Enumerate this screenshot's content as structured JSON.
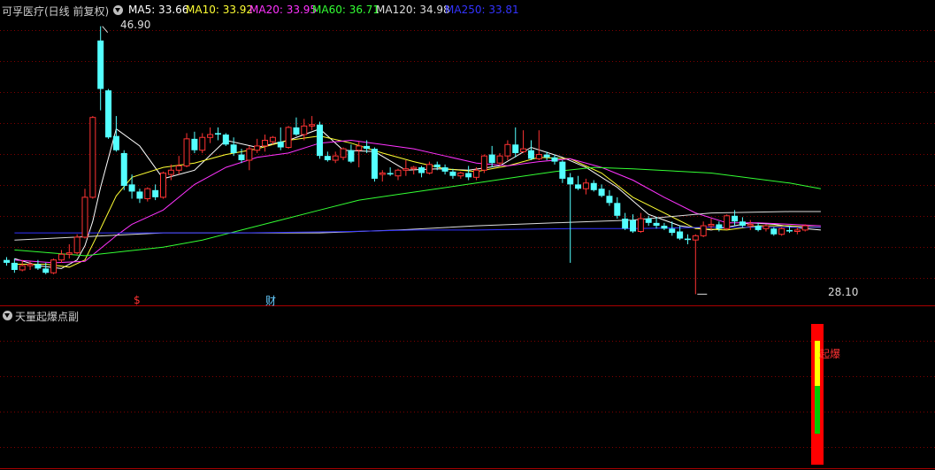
{
  "header": {
    "title": "可孚医疗(日线 前复权)",
    "ma": [
      {
        "label": "MA5: 33.66",
        "color": "#ffffff"
      },
      {
        "label": "MA10: 33.92",
        "color": "#ffff33"
      },
      {
        "label": "MA20: 33.95",
        "color": "#ff33ff"
      },
      {
        "label": "MA60: 36.71",
        "color": "#33ff33"
      },
      {
        "label": "MA120: 34.98",
        "color": "#dddddd"
      },
      {
        "label": "MA250: 33.81",
        "color": "#3333ff"
      }
    ]
  },
  "annotations": {
    "high": "46.90",
    "low": "28.10",
    "marker_dollar": "$",
    "marker_cai": "财"
  },
  "sub": {
    "title": "天量起爆点副",
    "signal_label": "起爆"
  },
  "colors": {
    "up": "#ff3333",
    "down": "#54ffff",
    "grid": "#800000",
    "signal_bar": "#ff0000",
    "signal_mid": "#ffff00",
    "signal_low": "#00cc00"
  },
  "chart_data": {
    "type": "candlestick",
    "y_range": [
      27.5,
      47.5
    ],
    "candles": [
      [
        30.5,
        30.7,
        30.1,
        30.3
      ],
      [
        30.3,
        30.6,
        29.6,
        29.8
      ],
      [
        29.8,
        30.5,
        29.7,
        30.1
      ],
      [
        30.1,
        30.4,
        29.8,
        30.2
      ],
      [
        30.2,
        30.5,
        29.8,
        29.9
      ],
      [
        29.9,
        30.3,
        29.5,
        29.6
      ],
      [
        29.6,
        30.6,
        29.5,
        30.5
      ],
      [
        30.5,
        31.2,
        30.3,
        30.9
      ],
      [
        30.9,
        31.6,
        30.6,
        31.0
      ],
      [
        31.0,
        32.3,
        30.9,
        32.1
      ],
      [
        32.1,
        35.5,
        32.0,
        34.9
      ],
      [
        34.9,
        40.6,
        34.8,
        40.5
      ],
      [
        45.9,
        46.9,
        41.0,
        42.5
      ],
      [
        42.4,
        42.5,
        39.0,
        39.1
      ],
      [
        39.2,
        40.6,
        38.1,
        38.2
      ],
      [
        38.0,
        38.2,
        35.4,
        35.7
      ],
      [
        35.8,
        36.5,
        34.8,
        35.3
      ],
      [
        35.3,
        35.5,
        34.5,
        34.8
      ],
      [
        34.8,
        35.6,
        34.6,
        35.5
      ],
      [
        35.4,
        35.8,
        34.7,
        34.9
      ],
      [
        34.9,
        36.7,
        34.8,
        36.6
      ],
      [
        36.5,
        37.2,
        36.1,
        36.8
      ],
      [
        36.8,
        37.8,
        36.5,
        37.1
      ],
      [
        37.1,
        39.4,
        37.0,
        39.0
      ],
      [
        39.0,
        39.5,
        38.0,
        38.2
      ],
      [
        38.2,
        39.4,
        38.0,
        39.1
      ],
      [
        39.1,
        39.8,
        38.7,
        39.3
      ],
      [
        39.4,
        39.8,
        38.9,
        39.3
      ],
      [
        39.3,
        39.4,
        38.5,
        38.6
      ],
      [
        38.6,
        39.1,
        37.8,
        38.0
      ],
      [
        37.9,
        38.3,
        37.3,
        37.5
      ],
      [
        37.5,
        38.5,
        36.8,
        38.3
      ],
      [
        38.2,
        39.0,
        38.0,
        38.5
      ],
      [
        38.5,
        39.3,
        38.1,
        38.9
      ],
      [
        38.8,
        39.2,
        38.6,
        39.1
      ],
      [
        38.8,
        39.8,
        38.2,
        38.4
      ],
      [
        38.4,
        39.9,
        38.3,
        39.8
      ],
      [
        39.8,
        40.5,
        39.2,
        39.3
      ],
      [
        39.3,
        40.4,
        38.9,
        39.9
      ],
      [
        39.9,
        40.6,
        39.6,
        40.0
      ],
      [
        40.0,
        40.2,
        37.6,
        37.8
      ],
      [
        37.8,
        38.1,
        37.4,
        37.5
      ],
      [
        37.5,
        38.1,
        37.3,
        37.8
      ],
      [
        37.7,
        38.4,
        37.5,
        38.3
      ],
      [
        38.2,
        38.6,
        37.3,
        37.4
      ],
      [
        38.2,
        38.8,
        37.0,
        38.5
      ],
      [
        38.5,
        38.9,
        38.0,
        38.3
      ],
      [
        38.3,
        38.4,
        36.0,
        36.2
      ],
      [
        36.5,
        36.8,
        36.0,
        36.6
      ],
      [
        36.6,
        37.0,
        36.4,
        36.5
      ],
      [
        36.4,
        36.9,
        36.1,
        36.8
      ],
      [
        36.8,
        37.5,
        36.4,
        36.9
      ],
      [
        36.9,
        37.1,
        36.5,
        37.0
      ],
      [
        37.0,
        37.1,
        36.3,
        36.6
      ],
      [
        36.6,
        37.4,
        36.5,
        37.2
      ],
      [
        37.2,
        37.4,
        36.8,
        37.0
      ],
      [
        37.0,
        37.2,
        36.5,
        36.7
      ],
      [
        36.7,
        36.9,
        36.2,
        36.4
      ],
      [
        36.4,
        36.7,
        36.2,
        36.6
      ],
      [
        36.6,
        37.1,
        36.1,
        36.3
      ],
      [
        36.3,
        37.0,
        36.1,
        36.8
      ],
      [
        36.8,
        37.9,
        36.6,
        37.8
      ],
      [
        37.9,
        38.5,
        37.0,
        37.3
      ],
      [
        37.3,
        38.0,
        37.1,
        37.8
      ],
      [
        37.8,
        38.9,
        37.5,
        38.6
      ],
      [
        38.6,
        39.8,
        37.7,
        38.0
      ],
      [
        38.1,
        39.6,
        38.0,
        38.3
      ],
      [
        38.2,
        38.9,
        37.5,
        37.6
      ],
      [
        37.6,
        39.6,
        37.5,
        37.9
      ],
      [
        37.9,
        38.1,
        37.5,
        37.7
      ],
      [
        37.7,
        37.9,
        37.2,
        37.4
      ],
      [
        37.4,
        37.5,
        35.9,
        36.2
      ],
      [
        36.3,
        36.6,
        30.3,
        35.8
      ],
      [
        35.8,
        36.4,
        35.4,
        35.5
      ],
      [
        35.5,
        36.2,
        35.1,
        35.9
      ],
      [
        35.9,
        36.1,
        35.3,
        35.4
      ],
      [
        35.5,
        35.8,
        34.9,
        35.0
      ],
      [
        35.0,
        35.4,
        34.3,
        34.5
      ],
      [
        34.5,
        34.9,
        33.4,
        33.6
      ],
      [
        33.4,
        33.8,
        32.6,
        32.7
      ],
      [
        33.3,
        33.7,
        32.4,
        32.5
      ],
      [
        32.5,
        33.8,
        32.4,
        33.4
      ],
      [
        33.4,
        33.6,
        32.9,
        33.1
      ],
      [
        33.1,
        33.5,
        32.7,
        32.9
      ],
      [
        32.9,
        33.1,
        32.6,
        32.7
      ],
      [
        32.7,
        33.2,
        32.2,
        32.4
      ],
      [
        32.5,
        32.9,
        31.9,
        32.0
      ],
      [
        32.0,
        32.3,
        31.6,
        31.9
      ],
      [
        31.9,
        32.3,
        28.1,
        32.2
      ],
      [
        32.2,
        33.2,
        32.1,
        32.9
      ],
      [
        32.9,
        33.4,
        32.6,
        33.0
      ],
      [
        33.0,
        33.2,
        32.5,
        32.7
      ],
      [
        32.7,
        33.7,
        32.6,
        33.6
      ],
      [
        33.6,
        34.0,
        32.9,
        33.2
      ],
      [
        33.2,
        33.5,
        32.8,
        32.9
      ],
      [
        32.9,
        33.3,
        32.6,
        33.0
      ],
      [
        32.9,
        33.1,
        32.5,
        32.6
      ],
      [
        32.7,
        33.0,
        32.5,
        32.9
      ],
      [
        32.7,
        32.8,
        32.2,
        32.3
      ],
      [
        32.3,
        32.8,
        32.2,
        32.7
      ],
      [
        32.6,
        32.9,
        32.4,
        32.5
      ],
      [
        32.5,
        32.8,
        32.3,
        32.6
      ],
      [
        32.6,
        33.0,
        32.5,
        32.9
      ]
    ],
    "ma_series": [
      {
        "name": "MA5",
        "color": "#ffffff",
        "points": [
          [
            1,
            30.6
          ],
          [
            4,
            30.1
          ],
          [
            7,
            29.9
          ],
          [
            9,
            30.5
          ],
          [
            10,
            31.5
          ],
          [
            11,
            33.2
          ],
          [
            12,
            35.6
          ],
          [
            14,
            39.7
          ],
          [
            17,
            38.5
          ],
          [
            20,
            36.2
          ],
          [
            24,
            36.8
          ],
          [
            28,
            38.9
          ],
          [
            32,
            38.4
          ],
          [
            36,
            38.9
          ],
          [
            40,
            39.7
          ],
          [
            43,
            38.2
          ],
          [
            47,
            38.1
          ],
          [
            51,
            36.8
          ],
          [
            55,
            36.9
          ],
          [
            59,
            36.8
          ],
          [
            63,
            37.1
          ],
          [
            67,
            38.4
          ],
          [
            71,
            37.7
          ],
          [
            74,
            37.0
          ],
          [
            78,
            35.6
          ],
          [
            82,
            33.7
          ],
          [
            86,
            32.9
          ],
          [
            90,
            32.6
          ],
          [
            95,
            33.1
          ],
          [
            98,
            33.0
          ],
          [
            102,
            32.7
          ],
          [
            104,
            32.6
          ]
        ]
      },
      {
        "name": "MA10",
        "color": "#ffff33",
        "points": [
          [
            1,
            30.2
          ],
          [
            5,
            30.2
          ],
          [
            8,
            30.0
          ],
          [
            10,
            30.5
          ],
          [
            12,
            32.7
          ],
          [
            14,
            35.0
          ],
          [
            16,
            36.3
          ],
          [
            20,
            37.0
          ],
          [
            24,
            37.3
          ],
          [
            28,
            37.9
          ],
          [
            32,
            38.3
          ],
          [
            36,
            38.9
          ],
          [
            40,
            39.2
          ],
          [
            44,
            38.7
          ],
          [
            48,
            38.0
          ],
          [
            52,
            37.4
          ],
          [
            56,
            36.9
          ],
          [
            60,
            36.7
          ],
          [
            64,
            37.1
          ],
          [
            68,
            37.7
          ],
          [
            72,
            37.6
          ],
          [
            76,
            36.6
          ],
          [
            80,
            34.9
          ],
          [
            84,
            33.8
          ],
          [
            88,
            32.7
          ],
          [
            92,
            32.6
          ],
          [
            96,
            32.9
          ],
          [
            100,
            32.9
          ],
          [
            104,
            32.8
          ]
        ]
      },
      {
        "name": "MA20",
        "color": "#ff33ff",
        "points": [
          [
            1,
            30.5
          ],
          [
            6,
            30.3
          ],
          [
            10,
            30.4
          ],
          [
            12,
            31.3
          ],
          [
            14,
            32.2
          ],
          [
            16,
            33.0
          ],
          [
            20,
            34.0
          ],
          [
            24,
            35.8
          ],
          [
            28,
            37.0
          ],
          [
            32,
            37.7
          ],
          [
            36,
            38.0
          ],
          [
            40,
            38.7
          ],
          [
            44,
            38.9
          ],
          [
            48,
            38.6
          ],
          [
            52,
            38.3
          ],
          [
            56,
            37.8
          ],
          [
            60,
            37.3
          ],
          [
            64,
            37.1
          ],
          [
            68,
            37.4
          ],
          [
            72,
            37.6
          ],
          [
            76,
            37.0
          ],
          [
            80,
            36.1
          ],
          [
            84,
            34.9
          ],
          [
            88,
            33.8
          ],
          [
            92,
            33.1
          ],
          [
            96,
            33.1
          ],
          [
            100,
            33.0
          ],
          [
            104,
            32.9
          ]
        ]
      },
      {
        "name": "MA60",
        "color": "#33ff33",
        "points": [
          [
            1,
            31.2
          ],
          [
            10,
            30.8
          ],
          [
            15,
            31.1
          ],
          [
            20,
            31.4
          ],
          [
            25,
            31.9
          ],
          [
            30,
            32.6
          ],
          [
            35,
            33.3
          ],
          [
            40,
            34.0
          ],
          [
            45,
            34.7
          ],
          [
            50,
            35.1
          ],
          [
            55,
            35.5
          ],
          [
            60,
            35.9
          ],
          [
            65,
            36.3
          ],
          [
            70,
            36.7
          ],
          [
            75,
            37.0
          ],
          [
            80,
            36.9
          ],
          [
            90,
            36.6
          ],
          [
            100,
            35.9
          ],
          [
            104,
            35.5
          ]
        ]
      },
      {
        "name": "MA120",
        "color": "#dddddd",
        "points": [
          [
            1,
            31.9
          ],
          [
            20,
            32.4
          ],
          [
            40,
            32.4
          ],
          [
            50,
            32.6
          ],
          [
            60,
            32.9
          ],
          [
            70,
            33.1
          ],
          [
            80,
            33.3
          ],
          [
            90,
            33.8
          ],
          [
            100,
            33.9
          ],
          [
            104,
            33.9
          ]
        ]
      },
      {
        "name": "MA250",
        "color": "#3333ff",
        "points": [
          [
            1,
            32.4
          ],
          [
            10,
            32.4
          ],
          [
            30,
            32.4
          ],
          [
            44,
            32.5
          ],
          [
            52,
            32.6
          ],
          [
            60,
            32.6
          ],
          [
            72,
            32.7
          ],
          [
            80,
            32.7
          ],
          [
            90,
            32.8
          ],
          [
            104,
            32.8
          ]
        ]
      }
    ]
  }
}
